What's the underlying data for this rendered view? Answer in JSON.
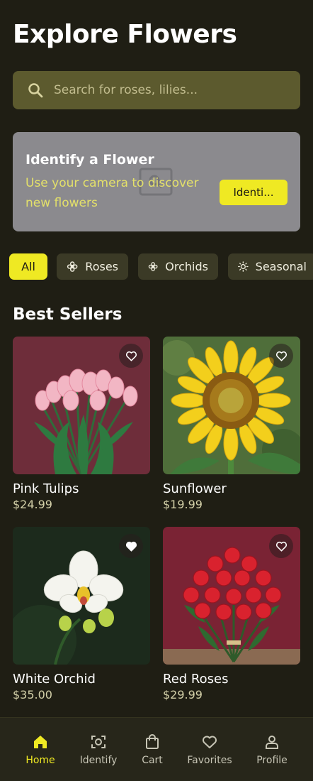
{
  "header": {
    "title": "Explore Flowers"
  },
  "search": {
    "placeholder": "Search for roses, lilies...",
    "icon": "search-icon"
  },
  "identify_card": {
    "title": "Identify a Flower",
    "description": "Use your camera to discover new flowers",
    "button_label": "Identi...",
    "icon": "image-search-icon"
  },
  "categories": [
    {
      "label": "All",
      "active": true
    },
    {
      "label": "Roses",
      "icon": "flower-icon"
    },
    {
      "label": "Orchids",
      "icon": "flower-icon"
    },
    {
      "label": "Seasonal",
      "icon": "sun-icon"
    }
  ],
  "best_sellers": {
    "title": "Best Sellers",
    "products": [
      {
        "name": "Pink Tulips",
        "price": "$24.99",
        "favorited": false
      },
      {
        "name": "Sunflower",
        "price": "$19.99",
        "favorited": false
      },
      {
        "name": "White Orchid",
        "price": "$35.00",
        "favorited": true
      },
      {
        "name": "Red Roses",
        "price": "$29.99",
        "favorited": false
      }
    ]
  },
  "bottom_nav": [
    {
      "label": "Home",
      "icon": "home-icon",
      "active": true
    },
    {
      "label": "Identify",
      "icon": "scan-icon"
    },
    {
      "label": "Cart",
      "icon": "shopping-bag-icon"
    },
    {
      "label": "Favorites",
      "icon": "heart-icon"
    },
    {
      "label": "Profile",
      "icon": "person-icon"
    }
  ],
  "colors": {
    "background": "#1f1e14",
    "accent": "#efe923",
    "search_bg": "#5c5a2e",
    "chip_bg": "#3b3a26"
  }
}
